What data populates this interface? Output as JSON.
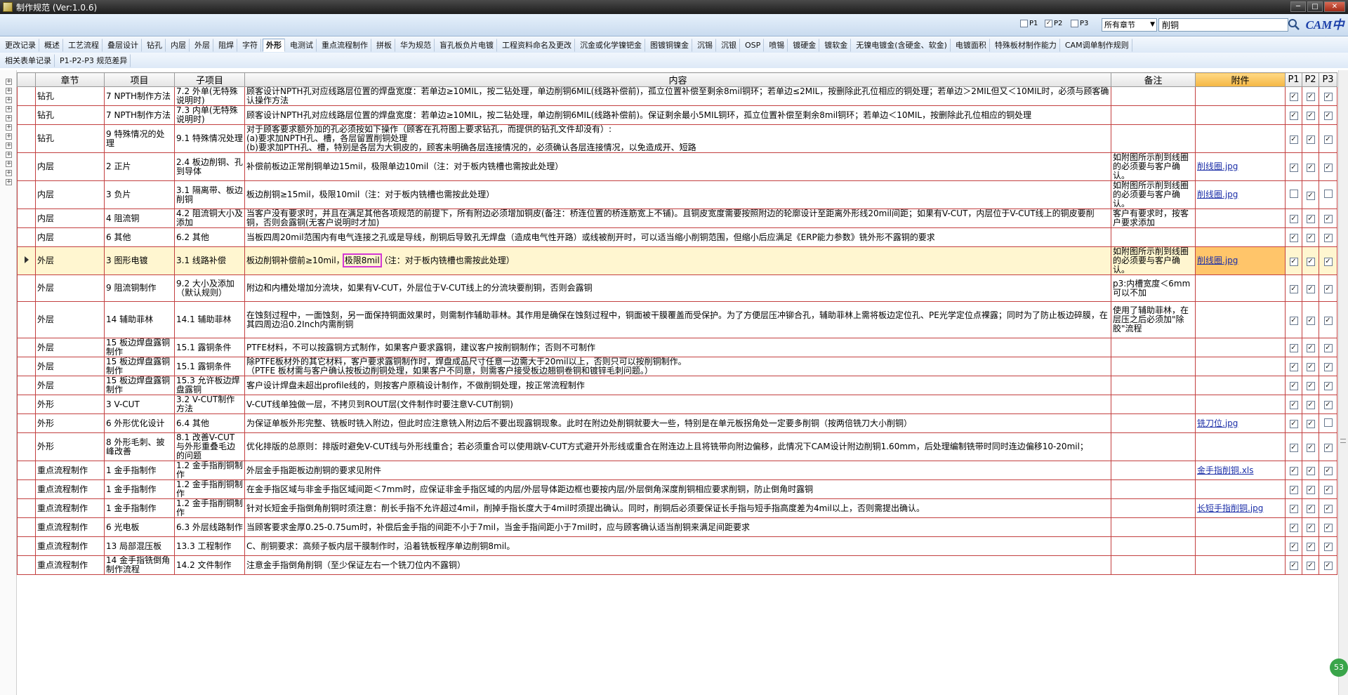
{
  "window": {
    "title": "制作规范 (Ver:1.0.6)",
    "minimize": "─",
    "maximize": "□",
    "close": "✕"
  },
  "filter": {
    "p1": {
      "label": "P1",
      "checked": false
    },
    "p2": {
      "label": "P2",
      "checked": true
    },
    "p3": {
      "label": "P3",
      "checked": false
    },
    "scope_selected": "所有章节",
    "search_value": "削铜",
    "logo": "CAM中心"
  },
  "tabs_row1": [
    "更改记录",
    "概述",
    "工艺流程",
    "叠层设计",
    "钻孔",
    "内层",
    "外层",
    "阻焊",
    "字符",
    "外形",
    "电测试",
    "重点流程制作",
    "拼板",
    "华为规范",
    "盲孔板负片电镀",
    "工程资料命名及更改",
    "沉金或化学镍钯金",
    "图镀铜镍金",
    "沉锡",
    "沉银",
    "OSP",
    "喷锡",
    "镀硬金",
    "镀软金",
    "无镍电镀金(含硬金、软金)",
    "电镀面积",
    "特殊板材制作能力",
    "CAM调单制作规则"
  ],
  "active_tab": "外形",
  "tabs_row2": [
    "相关表单记录",
    "P1-P2-P3 规范差异"
  ],
  "table": {
    "headers": {
      "chapter": "章节",
      "item": "项目",
      "subitem": "子项目",
      "content": "内容",
      "note": "备注",
      "attach": "附件",
      "p1": "P1",
      "p2": "P2",
      "p3": "P3"
    },
    "rows": [
      {
        "chapter": "钻孔",
        "item": "7 NPTH制作方法",
        "sub": "7.2 外单(无特殊说明时)",
        "content": "顾客设计NPTH孔对应线路层位置的焊盘宽度：若单边≥10MIL，按二钻处理，单边削铜6MIL(线路补偿前)，孤立位置补偿至剩余8mil铜环；若单边≤2MIL，按删除此孔位相应的铜处理；若单边＞2MIL但又＜10MIL时，必须与顾客确认操作方法",
        "note": "",
        "attach": "",
        "p": [
          1,
          1,
          1
        ]
      },
      {
        "chapter": "钻孔",
        "item": "7 NPTH制作方法",
        "sub": "7.3 内单(无特殊说明时)",
        "content": "顾客设计NPTH孔对应线路层位置的焊盘宽度：若单边≥10MIL，按二钻处理，单边削铜6MIL(线路补偿前)。保证剩余最小5MIL铜环，孤立位置补偿至剩余8mil铜环；若单边＜10MIL，按删除此孔位相应的铜处理",
        "note": "",
        "attach": "",
        "p": [
          1,
          1,
          1
        ]
      },
      {
        "chapter": "钻孔",
        "item": "9 特殊情况的处理",
        "sub": "9.1 特殊情况处理",
        "content": "对于顾客要求额外加的孔必须按如下操作（顾客在孔符图上要求钻孔，而提供的钻孔文件却没有）:\n(a)要求加NPTH孔、槽，各层留置削铜处理\n(b)要求加PTH孔、槽，特别是各层为大铜皮的，顾客未明确各层连接情况的，必须确认各层连接情况，以免造成开、短路",
        "note": "",
        "attach": "",
        "p": [
          1,
          1,
          1
        ]
      },
      {
        "chapter": "内层",
        "item": "2 正片",
        "sub": "2.4 板边削铜、孔到导体",
        "content": "补偿前板边正常削铜单边15mil，极限单边10mil（注：对于板内铣槽也需按此处理）",
        "note": "如附图所示削到线圈的必须要与客户确认。",
        "attach": "削线圈.jpg",
        "p": [
          1,
          1,
          1
        ]
      },
      {
        "chapter": "内层",
        "item": "3 负片",
        "sub": "3.1 隔离带、板边削铜",
        "content": "板边削铜≥15mil，极限10mil（注：对于板内铣槽也需按此处理）",
        "note": "如附图所示削到线圈的必须要与客户确认。",
        "attach": "削线圈.jpg",
        "p": [
          0,
          1,
          0
        ]
      },
      {
        "chapter": "内层",
        "item": "4 阻流铜",
        "sub": "4.2 阻流铜大小及添加",
        "content": "当客户没有要求时，并且在满足其他各项规范的前提下，所有附边必须增加铜皮(备注：桥连位置的桥连筋宽上不铺)。且铜皮宽度需要按照附边的轮廓设计至距离外形线20mil间距；如果有V-CUT，内层位于V-CUT线上的铜皮要削铜，否则会露铜(无客户说明时才加)",
        "note": "客户有要求时，按客户要求添加",
        "attach": "",
        "p": [
          1,
          1,
          1
        ]
      },
      {
        "chapter": "内层",
        "item": "6 其他",
        "sub": "6.2 其他",
        "content": "当板四周20mil范围内有电气连接之孔或是导线，削铜后导致孔无焊盘（造成电气性开路）或线被削开时，可以适当缩小削铜范围，但缩小后应满足《ERP能力参数》铣外形不露铜的要求",
        "note": "",
        "attach": "",
        "p": [
          1,
          1,
          1
        ]
      },
      {
        "chapter": "外层",
        "item": "3 图形电镀",
        "sub": "3.1 线路补偿",
        "content_a": "板边削铜补偿前≥10mil，",
        "content_mark": "极限8mil",
        "content_b": "（注：对于板内铣槽也需按此处理）",
        "note": "如附图所示削到线圈的必须要与客户确认。",
        "attach": "削线圈.jpg",
        "p": [
          1,
          1,
          1
        ],
        "highlight": true
      },
      {
        "chapter": "外层",
        "item": "9 阻流铜制作",
        "sub": "9.2 大小及添加（默认规则）",
        "content": "附边和内槽处增加分流块，如果有V-CUT，外层位于V-CUT线上的分流块要削铜，否则会露铜",
        "note": "p3:内槽宽度＜6mm可以不加",
        "attach": "",
        "p": [
          1,
          1,
          1
        ]
      },
      {
        "chapter": "外层",
        "item": "14 辅助菲林",
        "sub": "14.1 辅助菲林",
        "content": "在蚀刻过程中，一面蚀刻，另一面保持铜面效果时，则需制作辅助菲林。其作用是确保在蚀刻过程中，铜面被干膜覆盖而受保护。为了方便层压冲铆合孔，辅助菲林上需将板边定位孔、PE光学定位点裸露；同时为了防止板边碎膜，在其四周边沿0.2Inch内需削铜",
        "note": "使用了辅助菲林，在层压之后必须加\"除胶\"流程",
        "attach": "",
        "p": [
          1,
          1,
          1
        ]
      },
      {
        "chapter": "外层",
        "item": "15 板边焊盘露铜制作",
        "sub": "15.1 露铜条件",
        "content": "PTFE材料，不可以按露铜方式制作，如果客户要求露铜，建议客户按削铜制作；否则不可制作",
        "note": "",
        "attach": "",
        "p": [
          1,
          1,
          1
        ]
      },
      {
        "chapter": "外层",
        "item": "15 板边焊盘露铜制作",
        "sub": "15.1 露铜条件",
        "content": "除PTFE板材外的其它材料，客户要求露铜制作时，焊盘成品尺寸任意一边需大于20mil以上，否则只可以按削铜制作。\n（PTFE 板材需与客户确认按板边削铜处理，如果客户不同意，则需客户接受板边翘铜卷铜和镀锌毛刺问题。）",
        "note": "",
        "attach": "",
        "p": [
          1,
          1,
          1
        ]
      },
      {
        "chapter": "外层",
        "item": "15 板边焊盘露铜制作",
        "sub": "15.3 允许板边焊盘露铜",
        "content": "客户设计焊盘未超出profile线的，则按客户原稿设计制作，不做削铜处理，按正常流程制作",
        "note": "",
        "attach": "",
        "p": [
          1,
          1,
          1
        ]
      },
      {
        "chapter": "外形",
        "item": "3 V-CUT",
        "sub": "3.2 V-CUT制作方法",
        "content": "V-CUT线单独做一层，不拷贝到ROUT层(文件制作时要注意V-CUT削铜)",
        "note": "",
        "attach": "",
        "p": [
          1,
          1,
          1
        ]
      },
      {
        "chapter": "外形",
        "item": "6 外形优化设计",
        "sub": "6.4 其他",
        "content": "为保证单板外形完整、铣板时铣入附边，但此时应注意铣入附边后不要出现露铜现象。此时在附边处削铜就要大一些，特别是在单元板拐角处一定要多削铜（按两倍铣刀大小削铜）",
        "note": "",
        "attach": "铣刀位.jpg",
        "p": [
          1,
          1,
          0
        ]
      },
      {
        "chapter": "外形",
        "item": "8 外形毛刺、披峰改善",
        "sub": "8.1 改善V-CUT与外形重叠毛边的问题",
        "content": "优化排版的总原则：排版时避免V-CUT线与外形线重合；若必须重合可以使用跳V-CUT方式避开外形线或重合在附连边上且将铣带向附边偏移，此情况下CAM设计附边削铜1.60mm，后处理编制铣带时同时连边偏移10-20mil；",
        "note": "",
        "attach": "",
        "p": [
          1,
          1,
          1
        ]
      },
      {
        "chapter": "重点流程制作",
        "item": "1 金手指制作",
        "sub": "1.2 金手指削铜制作",
        "content": "外层金手指距板边削铜的要求见附件",
        "note": "",
        "attach": "金手指削铜.xls",
        "p": [
          1,
          1,
          1
        ]
      },
      {
        "chapter": "重点流程制作",
        "item": "1 金手指制作",
        "sub": "1.2 金手指削铜制作",
        "content": "在金手指区域与非金手指区域间距＜7mm时，应保证非金手指区域的内层/外层导体距边框也要按内层/外层倒角深度削铜相应要求削铜，防止倒角时露铜",
        "note": "",
        "attach": "",
        "p": [
          1,
          1,
          1
        ]
      },
      {
        "chapter": "重点流程制作",
        "item": "1 金手指制作",
        "sub": "1.2 金手指削铜制作",
        "content": "针对长短金手指倒角削铜时须注意：削长手指不允许超过4mil，削掉手指长度大于4mil时须提出确认。同时，削铜后必须要保证长手指与短手指高度差为4mil以上，否则需提出确认。",
        "note": "",
        "attach": "长短手指削铜.jpg",
        "p": [
          1,
          1,
          1
        ]
      },
      {
        "chapter": "重点流程制作",
        "item": "6 光电板",
        "sub": "6.3 外层线路制作",
        "content": "当顾客要求金厚0.25-0.75um时，补偿后金手指的间距不小于7mil，当金手指间距小于7mil时，应与顾客确认适当削铜来满足间距要求",
        "note": "",
        "attach": "",
        "p": [
          1,
          1,
          1
        ]
      },
      {
        "chapter": "重点流程制作",
        "item": "13 局部混压板",
        "sub": "13.3 工程制作",
        "content": "C、削铜要求：高频子板内层干膜制作时，沿着铣板程序单边削铜8mil。",
        "note": "",
        "attach": "",
        "p": [
          1,
          1,
          1
        ]
      },
      {
        "chapter": "重点流程制作",
        "item": "14 金手指铣倒角制作流程",
        "sub": "14.2 文件制作",
        "content": "注意金手指倒角削铜（至少保证左右一个铣刀位内不露铜）",
        "note": "",
        "attach": "",
        "p": [
          1,
          1,
          1
        ]
      }
    ]
  },
  "badge": "53"
}
